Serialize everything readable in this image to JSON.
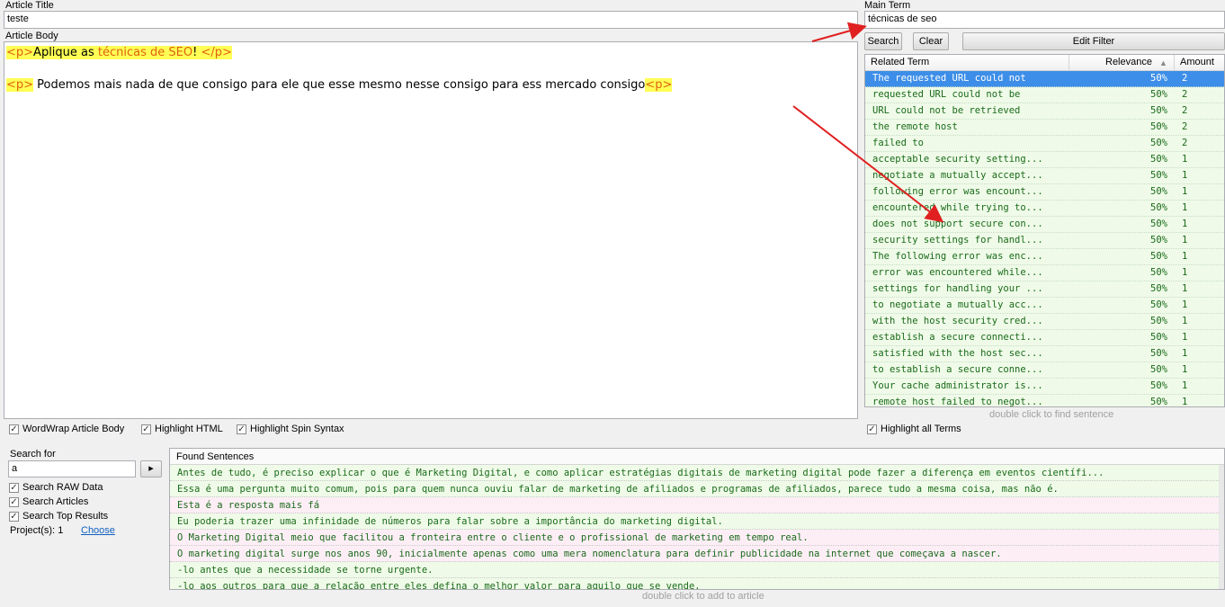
{
  "article_title": {
    "label": "Article Title",
    "value": "teste"
  },
  "article_body": {
    "label": "Article Body",
    "line1": {
      "tag_open": "<p>",
      "pre": "Aplique as ",
      "term": "técnicas de SEO",
      "post": "! ",
      "tag_close": "</p>"
    },
    "line2": {
      "tag_open": "<p>",
      "text": " Podemos mais nada de que consigo para ele que esse mesmo nesse consigo para ess mercado consigo",
      "tag_close": "<p>"
    }
  },
  "main_term": {
    "label": "Main Term",
    "value": "técnicas de seo"
  },
  "buttons": {
    "search": "Search",
    "clear": "Clear",
    "edit_filter": "Edit Filter",
    "go": "▸",
    "choose": "Choose"
  },
  "terms_table": {
    "headers": {
      "term": "Related Term",
      "relevance": "Relevance",
      "amount": "Amount"
    },
    "rows": [
      {
        "term": "The requested URL could not",
        "relevance": "50%",
        "amount": "2"
      },
      {
        "term": "requested URL could not be",
        "relevance": "50%",
        "amount": "2"
      },
      {
        "term": "URL could not be retrieved",
        "relevance": "50%",
        "amount": "2"
      },
      {
        "term": "the remote host",
        "relevance": "50%",
        "amount": "2"
      },
      {
        "term": "failed to",
        "relevance": "50%",
        "amount": "2"
      },
      {
        "term": "acceptable security setting...",
        "relevance": "50%",
        "amount": "1"
      },
      {
        "term": "negotiate a mutually accept...",
        "relevance": "50%",
        "amount": "1"
      },
      {
        "term": "following error was encount...",
        "relevance": "50%",
        "amount": "1"
      },
      {
        "term": "encountered while trying to...",
        "relevance": "50%",
        "amount": "1"
      },
      {
        "term": "does not support secure con...",
        "relevance": "50%",
        "amount": "1"
      },
      {
        "term": "security settings for handl...",
        "relevance": "50%",
        "amount": "1"
      },
      {
        "term": "The following error was enc...",
        "relevance": "50%",
        "amount": "1"
      },
      {
        "term": "error was encountered while...",
        "relevance": "50%",
        "amount": "1"
      },
      {
        "term": "settings for handling your ...",
        "relevance": "50%",
        "amount": "1"
      },
      {
        "term": "to negotiate a mutually acc...",
        "relevance": "50%",
        "amount": "1"
      },
      {
        "term": "with the host security cred...",
        "relevance": "50%",
        "amount": "1"
      },
      {
        "term": "establish a secure connecti...",
        "relevance": "50%",
        "amount": "1"
      },
      {
        "term": "satisfied with the host sec...",
        "relevance": "50%",
        "amount": "1"
      },
      {
        "term": "to establish a secure conne...",
        "relevance": "50%",
        "amount": "1"
      },
      {
        "term": "Your cache administrator is...",
        "relevance": "50%",
        "amount": "1"
      },
      {
        "term": "remote host failed to negot...",
        "relevance": "50%",
        "amount": "1"
      }
    ],
    "hint": "double click to find sentence"
  },
  "checkboxes": {
    "wordwrap": "WordWrap Article Body",
    "highlight_html": "Highlight HTML",
    "highlight_spin": "Highlight Spin Syntax",
    "highlight_terms": "Highlight all Terms"
  },
  "search_panel": {
    "label": "Search for",
    "value": "a",
    "raw": "Search RAW Data",
    "articles": "Search Articles",
    "top": "Search Top Results",
    "projects_label": "Project(s):",
    "projects_count": "1"
  },
  "sentences": {
    "header": "Found Sentences",
    "rows": [
      {
        "text": "Antes de tudo, é preciso explicar o que é Marketing Digital, e como aplicar estratégias digitais de marketing digital pode fazer a diferença em eventos científi...",
        "tone": "g"
      },
      {
        "text": "Essa é uma pergunta muito comum, pois para quem nunca ouviu falar de marketing de afiliados e programas de afiliados, parece tudo a mesma coisa, mas não é.",
        "tone": "g"
      },
      {
        "text": "Esta é a resposta mais fá",
        "tone": "p"
      },
      {
        "text": "Eu poderia trazer uma infinidade de números para falar sobre a importância do marketing digital.",
        "tone": "g"
      },
      {
        "text": "O Marketing Digital meio que facilitou a fronteira entre o cliente e o profissional de marketing em tempo real.",
        "tone": "p"
      },
      {
        "text": "O marketing digital surge nos anos 90, inicialmente apenas como uma mera nomenclatura para definir publicidade na internet que começava a nascer.",
        "tone": "p"
      },
      {
        "text": "-lo antes que a necessidade se torne urgente.",
        "tone": "g"
      },
      {
        "text": "-lo aos outros para que a relação entre eles defina o melhor valor para aquilo que se vende.",
        "tone": "g"
      }
    ],
    "hint": "double click to add to article"
  },
  "colors": {
    "highlight": "#ffff55",
    "tag": "#e06010",
    "selected_row": "#3d8ee8",
    "arrow": "#e02020"
  }
}
